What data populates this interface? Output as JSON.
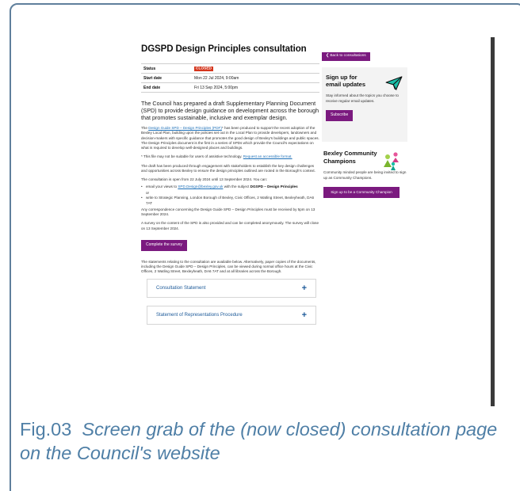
{
  "page": {
    "title": "DGSPD Design Principles consultation",
    "status_table": [
      {
        "key": "Status",
        "value": "CLOSED"
      },
      {
        "key": "Start date",
        "value": "Mon 22 Jul 2024, 9:00am"
      },
      {
        "key": "End date",
        "value": "Fri 13 Sep 2024, 5:00pm"
      }
    ],
    "intro": "The Council has prepared a draft Supplementary Planning Document (SPD) to provide design guidance on development across the borough that promotes sustainable, inclusive and exemplar design.",
    "para1_prefix": "The ",
    "para1_link": "Design Guide SPD – Design Principles (PDF)",
    "para1_rest": "* has been produced to support the recent adoption of the Bexley Local Plan, building upon the policies set out in the Local Plan to provide developers, landowners and decision-makers with specific guidance that promotes the good design of Bexley's buildings and public spaces. The Design Principles document is the first in a series of SPDs which provide the Council's expectations on what is required to develop well-designed places and buildings.",
    "para2_prefix": "* This file may not be suitable for users of assistive technology. ",
    "para2_link": "Request an accessible format.",
    "para3": "The draft has been produced through engagement with stakeholders to establish the key design challenges and opportunities across Bexley to ensure the design principles outlined are rooted in the Borough's context.",
    "para4": "The consultation is open from 22 July 2024 until 13 September 2024. You can:",
    "bullet1_prefix": "email your views to ",
    "bullet1_link": "SPD.Design@bexley.gov.uk",
    "bullet1_mid": " with the subject ",
    "bullet1_bold": "DGSPD – Design Principles",
    "or_text": "or",
    "bullet2": "write to Strategic Planning, London Borough of Bexley, Civic Offices, 2 Watling Street, Bexleyheath, DA6 7AT",
    "para5": "Any correspondence concerning the Design Guide SPD – Design Principles must be received by 5pm on 13 September 2024.",
    "para6": "A survey on the content of the SPD is also provided and can be completed anonymously. The survey will close on 13 September 2024.",
    "survey_button": "Complete the survey",
    "para7": "The statements relating to the consultation are available below. Alternatively, paper copies of the documents, including the Design Guide SPD – Design Principles, can be viewed during normal office hours at the Civic Offices, 2 Watling Street, Bexleyheath, DA6 7AT and at all libraries across the Borough.",
    "accordions": [
      "Consultation Statement",
      "Statement of Representations Procedure"
    ],
    "accordion_symbol": "+"
  },
  "sidebar": {
    "back_button": "❮  Back to consultations",
    "signup_title": "Sign up for email updates",
    "signup_text": "Stay informed about the topics you choose to receive regular email updates.",
    "subscribe_button": "Subscribe",
    "champions_title": "Bexley Community Champions",
    "champions_text": "Community minded people are being invited to sign up as Community Champions.",
    "champions_button": "Sign up to be a Community Champion"
  },
  "caption": {
    "fig": "Fig.03",
    "text": "Screen grab of the (now closed) consultation page on the Council's website"
  },
  "colors": {
    "brand_purple": "#7b1a7f",
    "closed_red": "#d4351c",
    "link_blue": "#1d70b8",
    "caption_blue": "#4f7fa6",
    "icon_teal": "#1bbfa8"
  },
  "icons": [
    "paper-plane-icon",
    "community-people-icon",
    "plus-icon"
  ]
}
